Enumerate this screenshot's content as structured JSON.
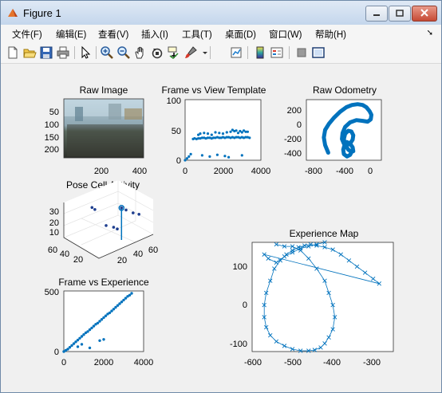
{
  "window": {
    "title": "Figure 1",
    "app_icon": "matlab-icon",
    "controls": [
      "minimize-icon",
      "maximize-icon",
      "close-icon"
    ]
  },
  "menubar": {
    "items": [
      {
        "label": "文件(F)"
      },
      {
        "label": "编辑(E)"
      },
      {
        "label": "查看(V)"
      },
      {
        "label": "插入(I)"
      },
      {
        "label": "工具(T)"
      },
      {
        "label": "桌面(D)"
      },
      {
        "label": "窗口(W)"
      },
      {
        "label": "帮助(H)"
      }
    ],
    "dock_icon": "dock-arrow-icon"
  },
  "toolbar": {
    "icons": [
      "new-figure-icon",
      "open-icon",
      "save-icon",
      "print-icon",
      "pointer-icon",
      "zoom-in-icon",
      "zoom-out-icon",
      "pan-icon",
      "rotate-3d-icon",
      "data-cursor-icon",
      "brush-icon",
      "link-plot-icon",
      "colorbar-icon",
      "legend-icon",
      "hide-plot-tools-icon",
      "show-plot-tools-icon"
    ],
    "colors": {
      "accent": "#0072bd"
    }
  },
  "figure": {
    "raw_image": {
      "title": "Raw Image",
      "yticks": [
        "50",
        "100",
        "150",
        "200"
      ],
      "xticks": [
        "200",
        "400"
      ]
    },
    "frame_vs_template": {
      "title": "Frame vs View Template",
      "yticks": [
        "0",
        "50",
        "100"
      ],
      "xticks": [
        "0",
        "2000",
        "4000"
      ]
    },
    "raw_odometry": {
      "title": "Raw Odometry",
      "yticks": [
        "200",
        "0",
        "-200",
        "-400"
      ],
      "xticks": [
        "-800",
        "-400",
        "0"
      ]
    },
    "pose_cell": {
      "title": "Pose Cell Activity",
      "zticks": [
        "30",
        "20",
        "10"
      ],
      "xticks": [
        "60",
        "40",
        "20"
      ],
      "yticks": [
        "20",
        "40",
        "60"
      ]
    },
    "frame_vs_experience": {
      "title": "Frame vs Experience",
      "yticks": [
        "0",
        "500"
      ],
      "xticks": [
        "0",
        "2000",
        "4000"
      ]
    },
    "experience_map": {
      "title": "Experience Map",
      "yticks": [
        "100",
        "0",
        "-100"
      ],
      "xticks": [
        "-600",
        "-500",
        "-400",
        "-300"
      ]
    }
  },
  "chart_data": [
    {
      "type": "heatmap",
      "title": "Raw Image",
      "xlim": [
        0,
        500
      ],
      "ylim": [
        0,
        240
      ],
      "ytick_values": [
        50,
        100,
        150,
        200
      ],
      "xtick_values": [
        200,
        400
      ]
    },
    {
      "type": "scatter",
      "title": "Frame vs View Template",
      "xlim": [
        0,
        4000
      ],
      "ylim": [
        0,
        100
      ],
      "series": [
        {
          "x": [
            0,
            100,
            200,
            300,
            420,
            500,
            600,
            700,
            800,
            900,
            1000,
            1100,
            1200,
            1300,
            1400,
            1500,
            1600,
            1700,
            1800,
            1900,
            2000,
            2100,
            2200,
            2300,
            2400,
            2500,
            2600,
            2700,
            2800,
            2900,
            3000,
            3100,
            3200,
            3300,
            3400,
            700,
            800,
            1000,
            1200,
            1400,
            1600,
            1800,
            2000,
            2200,
            2400,
            2600,
            2800,
            3000,
            3200,
            2500,
            2700,
            2900,
            3100,
            3300,
            900,
            1300,
            1700,
            2100,
            2300,
            3000
          ],
          "y": [
            0,
            3,
            6,
            10,
            35,
            36,
            35,
            36,
            36,
            37,
            37,
            36,
            37,
            37,
            36,
            37,
            37,
            38,
            37,
            37,
            38,
            37,
            38,
            38,
            37,
            38,
            37,
            38,
            38,
            37,
            38,
            37,
            38,
            38,
            37,
            42,
            44,
            45,
            44,
            42,
            46,
            45,
            44,
            46,
            47,
            48,
            45,
            46,
            47,
            50,
            49,
            48,
            49,
            47,
            8,
            6,
            9,
            7,
            5,
            8
          ]
        }
      ]
    },
    {
      "type": "line",
      "title": "Raw Odometry",
      "xlim": [
        -1000,
        200
      ],
      "ylim": [
        -500,
        300
      ],
      "series": [
        {
          "x": [
            -650,
            -700,
            -720,
            -700,
            -640,
            -560,
            -460,
            -360,
            -270,
            -180,
            -100,
            -40,
            10,
            40,
            30,
            -20,
            -100,
            -200,
            -300,
            -380,
            -420,
            -430,
            -400,
            -350,
            -300,
            -260,
            -250,
            -280,
            -330,
            -380,
            -400,
            -380,
            -330,
            -280,
            -250,
            -260,
            -300,
            -350,
            -390,
            -410,
            -400,
            -350,
            -300,
            -270
          ],
          "y": [
            -400,
            -300,
            -200,
            -100,
            -20,
            60,
            140,
            200,
            230,
            240,
            230,
            200,
            150,
            100,
            40,
            10,
            20,
            30,
            0,
            -60,
            -140,
            -220,
            -280,
            -300,
            -280,
            -230,
            -170,
            -120,
            -110,
            -150,
            -220,
            -300,
            -360,
            -390,
            -380,
            -330,
            -280,
            -260,
            -300,
            -360,
            -420,
            -450,
            -430,
            -380
          ]
        }
      ]
    },
    {
      "type": "scatter",
      "title": "Pose Cell Activity",
      "series": [
        {
          "x": [
            20,
            22,
            30,
            32,
            35,
            38,
            40,
            45,
            50
          ],
          "y": [
            20,
            22,
            30,
            40,
            42,
            45,
            50,
            55,
            58
          ],
          "z": [
            30,
            28,
            12,
            13,
            11,
            32,
            31,
            28,
            26
          ]
        }
      ]
    },
    {
      "type": "scatter",
      "title": "Frame vs Experience",
      "xlim": [
        0,
        4000
      ],
      "ylim": [
        0,
        500
      ],
      "series": [
        {
          "x": [
            0,
            100,
            200,
            300,
            400,
            500,
            600,
            700,
            800,
            900,
            1000,
            1100,
            1200,
            1300,
            1400,
            1500,
            1600,
            1700,
            1800,
            1900,
            2000,
            2100,
            2200,
            2300,
            2400,
            2500,
            2600,
            2700,
            2800,
            2900,
            3000,
            3100,
            3200,
            3300,
            3400,
            700,
            900,
            1300,
            1800,
            2000
          ],
          "y": [
            0,
            10,
            20,
            35,
            50,
            65,
            80,
            95,
            110,
            125,
            140,
            155,
            165,
            180,
            195,
            210,
            225,
            235,
            250,
            265,
            280,
            295,
            310,
            320,
            335,
            350,
            365,
            380,
            395,
            410,
            425,
            440,
            455,
            465,
            480,
            40,
            60,
            30,
            90,
            100
          ]
        }
      ]
    },
    {
      "type": "scatter",
      "title": "Experience Map",
      "xlim": [
        -600,
        -250
      ],
      "ylim": [
        -120,
        150
      ],
      "series": [
        {
          "x": [
            -540,
            -520,
            -500,
            -480,
            -460,
            -440,
            -420,
            -410,
            -400,
            -395,
            -400,
            -410,
            -420,
            -430,
            -445,
            -460,
            -480,
            -500,
            -520,
            -540,
            -555,
            -565,
            -570,
            -570,
            -565,
            -555,
            -545,
            -530,
            -515,
            -500,
            -485,
            -470,
            -455,
            -440,
            -420,
            -400,
            -380,
            -360,
            -340,
            -320,
            -300,
            -285,
            -570,
            -560,
            -540,
            -520,
            -500,
            -480,
            -460,
            -440,
            -420
          ],
          "y": [
            145,
            140,
            140,
            130,
            110,
            85,
            55,
            25,
            -5,
            -35,
            -65,
            -85,
            -100,
            -110,
            -116,
            -118,
            -118,
            -114,
            -106,
            -95,
            -80,
            -60,
            -35,
            -5,
            25,
            55,
            85,
            105,
            120,
            130,
            138,
            142,
            145,
            142,
            138,
            132,
            120,
            105,
            90,
            75,
            60,
            48,
            120,
            110,
            100,
            115,
            125,
            135,
            140,
            145,
            150
          ]
        }
      ]
    }
  ]
}
